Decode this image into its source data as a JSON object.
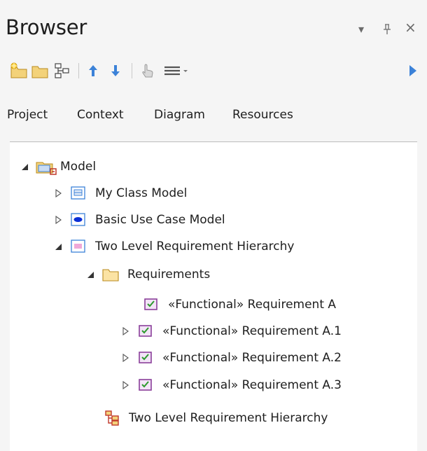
{
  "window": {
    "title": "Browser",
    "controls": {
      "menu": "▾",
      "pin": "⊥",
      "close": "×"
    }
  },
  "toolbar": {
    "buttons": [
      "new-package-icon",
      "folder-icon",
      "diagram-icon",
      "move-up-icon",
      "move-down-icon",
      "hand-pointer-icon",
      "menu-icon",
      "expand-arrow-icon"
    ]
  },
  "tabs": [
    {
      "label": "Project",
      "active": true
    },
    {
      "label": "Context",
      "active": false
    },
    {
      "label": "Diagram",
      "active": false
    },
    {
      "label": "Resources",
      "active": false
    }
  ],
  "tree": {
    "model": {
      "label": "Model",
      "expanded": true
    },
    "class_model": {
      "label": "My Class Model",
      "expanded": false
    },
    "use_case_model": {
      "label": "Basic Use Case Model",
      "expanded": false
    },
    "req_hierarchy": {
      "label": "Two Level Requirement Hierarchy",
      "expanded": true
    },
    "requirements": {
      "label": "Requirements",
      "expanded": true
    },
    "req_a": {
      "label": "«Functional» Requirement A"
    },
    "req_a1": {
      "label": "«Functional» Requirement A.1",
      "expanded": false
    },
    "req_a2": {
      "label": "«Functional» Requirement A.2",
      "expanded": false
    },
    "req_a3": {
      "label": "«Functional» Requirement A.3",
      "expanded": false
    },
    "diagram": {
      "label": "Two Level Requirement Hierarchy"
    }
  },
  "colors": {
    "accent_blue": "#3c82d8",
    "requirement_purple": "#8a3f9a",
    "check_green": "#2c9a2c",
    "folder_yellow": "#f3d27a",
    "diagram_red": "#c0392b"
  }
}
